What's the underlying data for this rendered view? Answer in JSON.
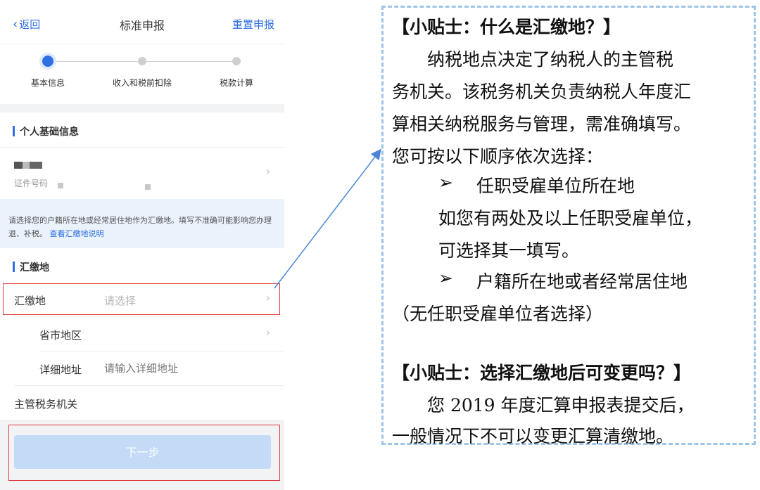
{
  "nav": {
    "back_label": "返回",
    "title": "标准申报",
    "reset_label": "重置申报"
  },
  "steps": [
    {
      "label": "基本信息",
      "active": true
    },
    {
      "label": "收入和税前扣除",
      "active": false
    },
    {
      "label": "税款计算",
      "active": false
    }
  ],
  "personal_section": {
    "title": "个人基础信息",
    "id_label": "证件号码"
  },
  "notice": {
    "text": "请选择您的户籍所在地或经常居住地作为汇缴地。填写不准确可能影响您办理退、补税。",
    "link": "查看汇缴地说明"
  },
  "location_section": {
    "title": "汇缴地",
    "rows": {
      "location": {
        "label": "汇缴地",
        "placeholder": "请选择"
      },
      "region": {
        "label": "省市地区"
      },
      "address": {
        "label": "详细地址",
        "placeholder": "请输入详细地址"
      },
      "tax_office": {
        "label": "主管税务机关"
      }
    }
  },
  "next_button": {
    "label": "下一步"
  },
  "tips": {
    "tip1_title": "【小贴士：什么是汇缴地？】",
    "tip1_lines": [
      "纳税地点决定了纳税人的主管税",
      "务机关。该税务机关负责纳税人年度汇",
      "算相关纳税服务与管理，需准确填写。",
      "您可按以下顺序依次选择："
    ],
    "bullet_symbol": "➢",
    "bullet1": "任职受雇单位所在地",
    "bullet1_note_lines": [
      "如您有两处及以上任职受雇单位，",
      "可选择其一填写。"
    ],
    "bullet2": "户籍所在地或者经常居住地",
    "bullet2_note": "（无任职受雇单位者选择）",
    "tip2_title": "【小贴士：选择汇缴地后可变更吗？】",
    "tip2_lines": [
      "您 2019 年度汇算申报表提交后，",
      "一般情况下不可以变更汇算清缴地。"
    ]
  },
  "colors": {
    "accent": "#2f6fe4",
    "highlight_border": "#e23b3b",
    "tips_border": "#9ec5e8",
    "connector": "#4a86d8"
  }
}
